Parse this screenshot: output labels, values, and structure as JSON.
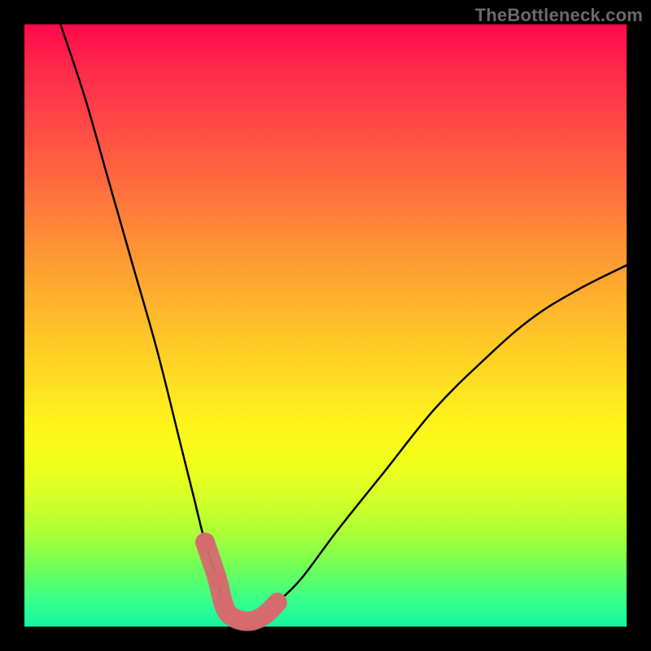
{
  "watermark": "TheBottleneck.com",
  "chart_data": {
    "type": "line",
    "title": "",
    "xlabel": "",
    "ylabel": "",
    "xlim": [
      0,
      100
    ],
    "ylim": [
      0,
      100
    ],
    "grid": false,
    "legend": false,
    "series": [
      {
        "name": "bottleneck-curve",
        "x": [
          6,
          10,
          14,
          18,
          22,
          26,
          28,
          30,
          32,
          33,
          34,
          36,
          38,
          40,
          42,
          46,
          52,
          60,
          68,
          76,
          84,
          92,
          100
        ],
        "values": [
          100,
          88,
          74,
          60,
          46,
          30,
          22,
          14,
          8,
          4,
          2,
          1,
          1,
          2,
          4,
          8,
          16,
          26,
          36,
          44,
          51,
          56,
          60
        ]
      },
      {
        "name": "highlight-band",
        "x": [
          30,
          32,
          33,
          34,
          36,
          38,
          40,
          42
        ],
        "values": [
          14,
          8,
          4,
          2,
          1,
          1,
          2,
          4
        ]
      }
    ],
    "annotations": []
  },
  "colors": {
    "curve": "#000000",
    "highlight": "#d56a6f",
    "background_top": "#ff0a4a",
    "background_bottom": "#14f7a0",
    "frame": "#000000"
  }
}
